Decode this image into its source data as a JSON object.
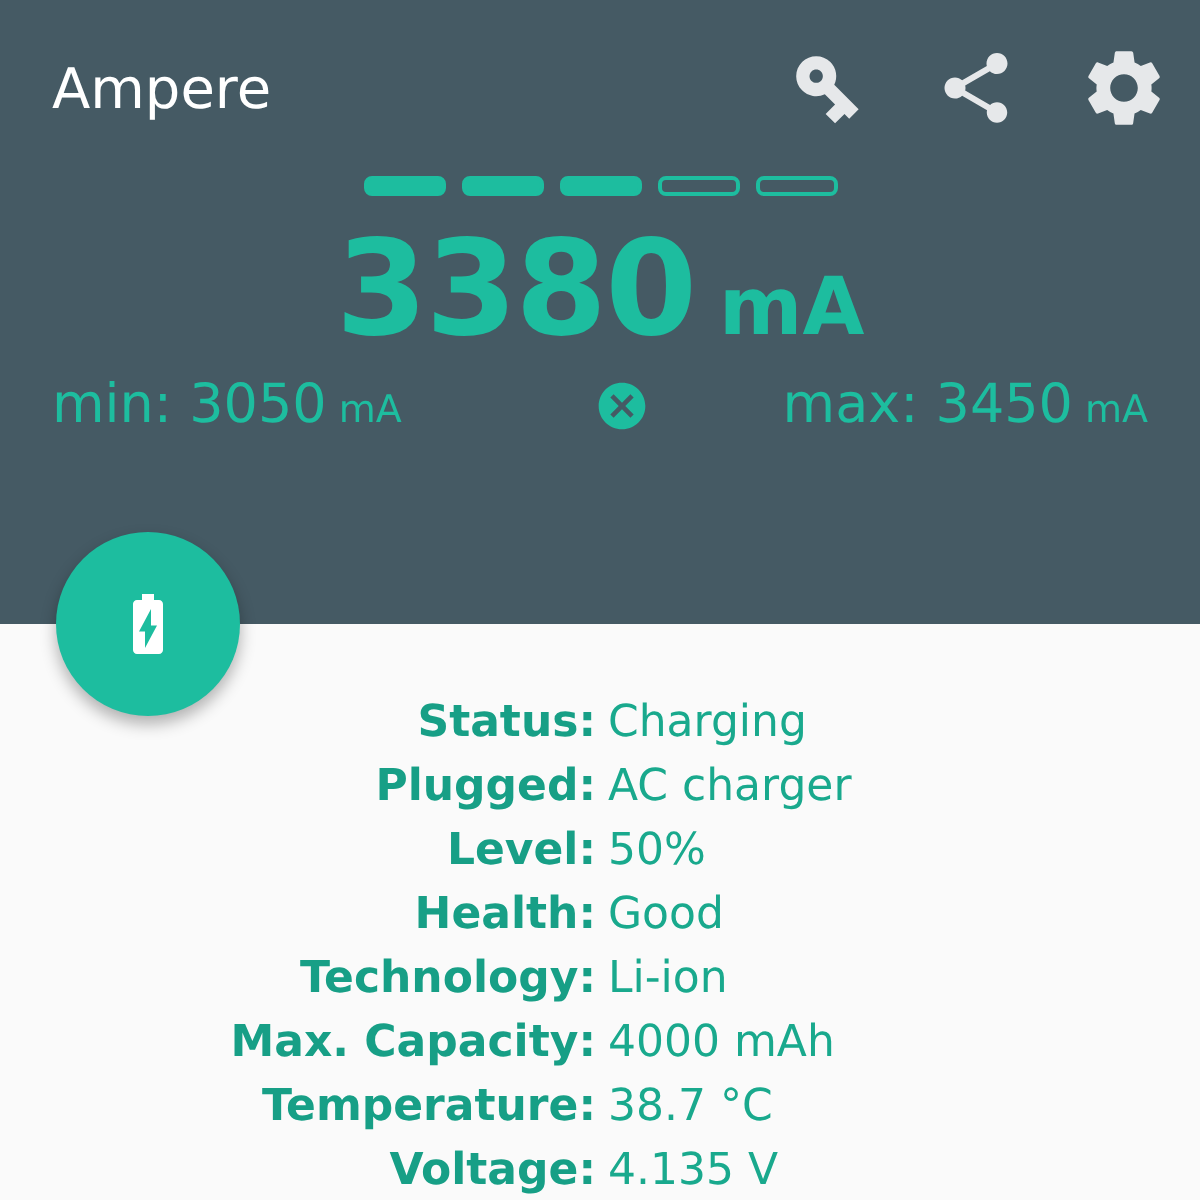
{
  "app_bar": {
    "title": "Ampere"
  },
  "meter": {
    "segments": [
      {
        "filled": true
      },
      {
        "filled": true
      },
      {
        "filled": true
      },
      {
        "filled": false
      },
      {
        "filled": false
      }
    ],
    "current": "3380",
    "current_unit": "mA",
    "min_label": "min: 3050",
    "min_unit": "mA",
    "max_label": "max: 3450",
    "max_unit": "mA"
  },
  "details": [
    {
      "label": "Status:",
      "value": "Charging"
    },
    {
      "label": "Plugged:",
      "value": "AC charger"
    },
    {
      "label": "Level:",
      "value": "50%"
    },
    {
      "label": "Health:",
      "value": "Good"
    },
    {
      "label": "Technology:",
      "value": "Li-ion"
    },
    {
      "label": "Max. Capacity:",
      "value": "4000 mAh"
    },
    {
      "label": "Temperature:",
      "value": "38.7 °C"
    },
    {
      "label": "Voltage:",
      "value": "4.135 V"
    }
  ]
}
